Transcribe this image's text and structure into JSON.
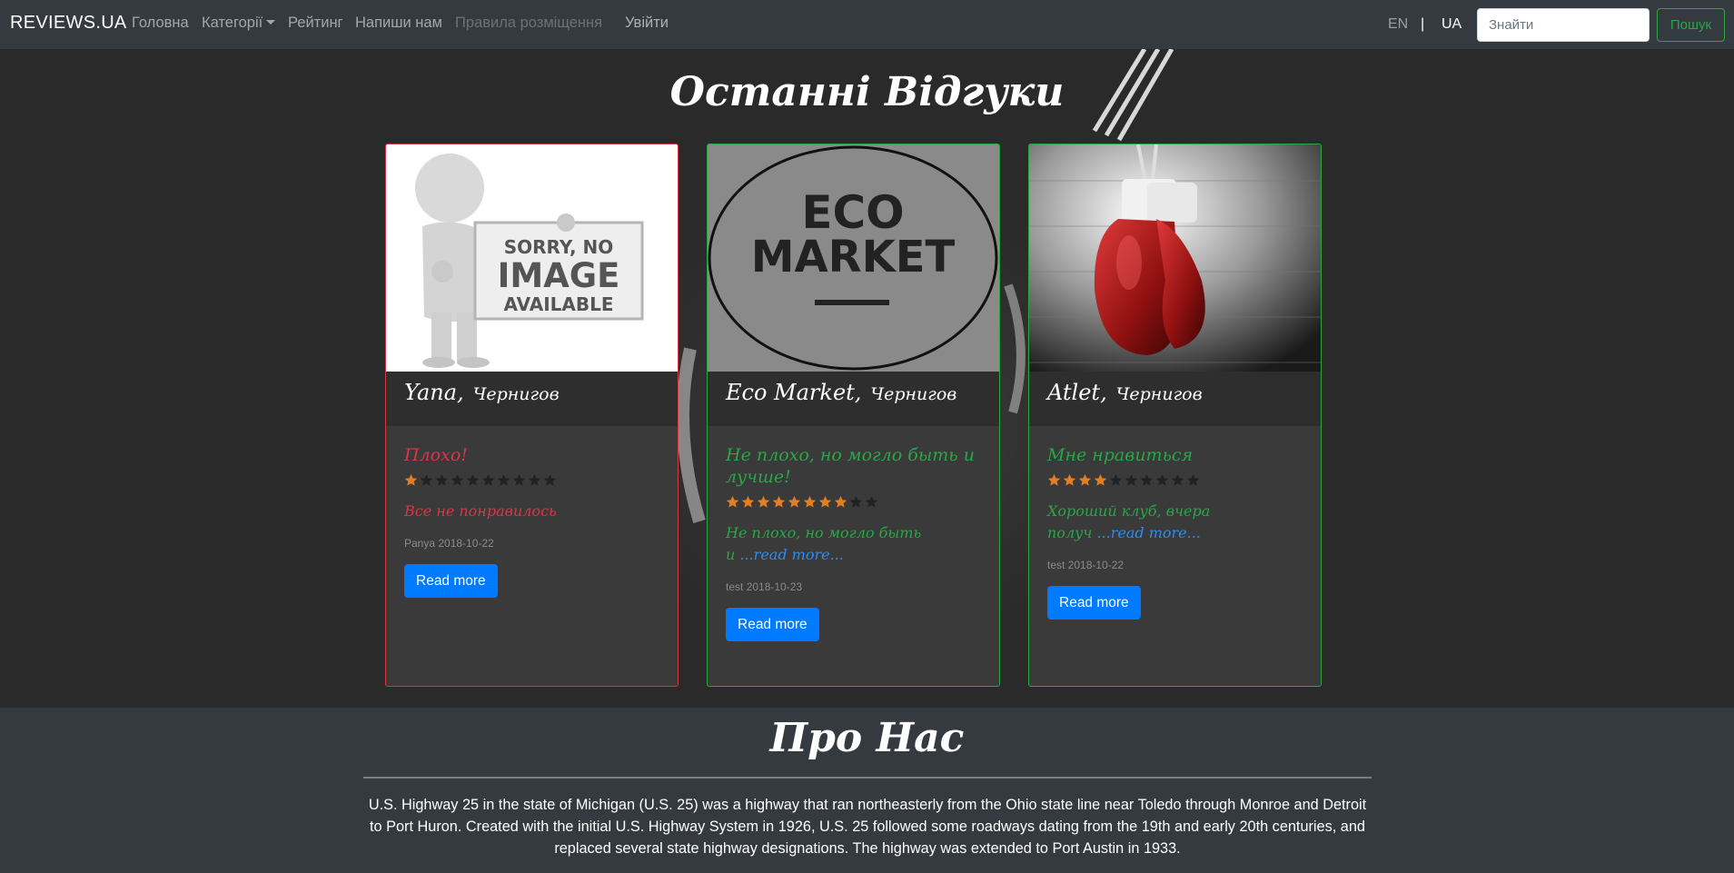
{
  "navbar": {
    "brand": "REVIEWS.UA",
    "links": [
      {
        "label": "Головна"
      },
      {
        "label": "Категорії"
      },
      {
        "label": "Рейтинг"
      },
      {
        "label": "Напиши нам"
      },
      {
        "label": "Правила розміщення"
      },
      {
        "label": "Увійти"
      }
    ],
    "lang_en": "EN",
    "lang_separator": "|",
    "lang_ua": "UA",
    "search_placeholder": "Знайти",
    "search_button": "Пошук"
  },
  "hero": {
    "title": "Останні Відгуки"
  },
  "cards": [
    {
      "image_text_1": "SORRY, NO",
      "image_text_2": "IMAGE",
      "image_text_3": "AVAILABLE",
      "name": "Yana,",
      "city": "Чернигов",
      "review_title": "Плохо!",
      "rating": 1,
      "max_rating": 10,
      "review_text": "Все не понравилось",
      "read_more_link": "",
      "meta": "Panya 2018-10-22",
      "button": "Read more",
      "accent": "#dc3545"
    },
    {
      "image_text_1": "ECO",
      "image_text_2": "MARKET",
      "name": "Eco Market,",
      "city": "Чернигов",
      "review_title": "Не плохо, но могло быть и лучше!",
      "rating": 8,
      "max_rating": 10,
      "review_text": "Не плохо, но могло быть и",
      "read_more_link": "...read more...",
      "meta": "test 2018-10-23",
      "button": "Read more",
      "accent": "#28a745"
    },
    {
      "name": "Atlet,",
      "city": "Чернигов",
      "review_title": "Мне нравиться",
      "rating": 4,
      "max_rating": 10,
      "review_text": "Хороший клуб, вчера получ",
      "read_more_link": "...read more...",
      "meta": "test 2018-10-22",
      "button": "Read more",
      "accent": "#28a745"
    }
  ],
  "about": {
    "title": "Про Нас",
    "text": "U.S. Highway 25 in the state of Michigan (U.S. 25) was a highway that ran northeasterly from the Ohio state line near Toledo through Monroe and Detroit to Port Huron. Created with the initial U.S. Highway System in 1926, U.S. 25 followed some roadways dating from the 19th and early 20th centuries, and replaced several state highway designations. The highway was extended to Port Austin in 1933."
  },
  "colors": {
    "star_on": "#e67e22",
    "star_off": "#222222",
    "primary": "#007bff",
    "success": "#28a745",
    "danger": "#dc3545"
  },
  "icons": [
    "star-icon",
    "caret-down-icon"
  ]
}
